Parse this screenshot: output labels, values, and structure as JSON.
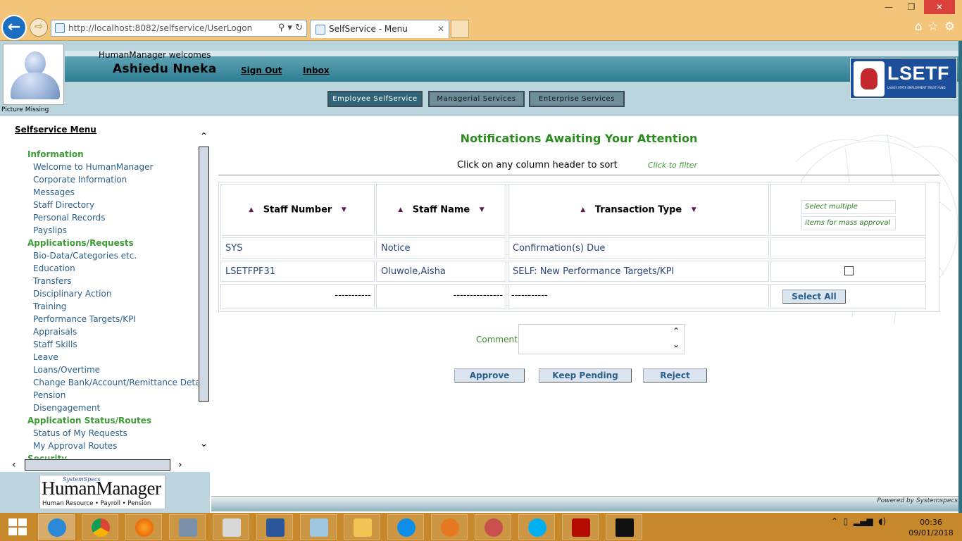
{
  "browser": {
    "url_prefix": "http://localhost",
    "url_rest": ":8082/selfservice/UserLogon",
    "tab_title": "SelfService - Menu",
    "window_controls": [
      "—",
      "❐",
      "✕"
    ]
  },
  "header": {
    "picture_missing": "Picture Missing",
    "welcome": "HumanManager welcomes",
    "user_name": "Ashiedu Nneka",
    "sign_out": "Sign Out",
    "inbox": "Inbox",
    "tabs": [
      "Employee SelfService",
      "Managerial Services",
      "Enterprise Services"
    ],
    "logo_text": "LSETF",
    "logo_sub": "LAGOS STATE EMPLOYMENT TRUST FUND"
  },
  "sidebar": {
    "title": "Selfservice Menu",
    "sections": [
      {
        "label": "Information",
        "items": [
          "Welcome to HumanManager",
          "Corporate Information",
          "Messages",
          "Staff Directory",
          "Personal Records",
          "Payslips"
        ]
      },
      {
        "label": "Applications/Requests",
        "items": [
          "Bio-Data/Categories etc.",
          "Education",
          "Transfers",
          "Disciplinary Action",
          "Training",
          "Performance Targets/KPI",
          "Appraisals",
          "Staff Skills",
          "Leave",
          "Loans/Overtime",
          "Change Bank/Account/Remittance Details",
          "Pension",
          "Disengagement"
        ]
      },
      {
        "label": "Application Status/Routes",
        "items": [
          "Status of My Requests",
          "My Approval Routes"
        ]
      },
      {
        "label": "Security",
        "items": []
      }
    ],
    "footer_logo": {
      "brand": "SystemSpecs",
      "name": "HumanManager",
      "tagline": "Human Resource • Payroll • Pension"
    }
  },
  "main": {
    "title": "Notifications Awaiting Your Attention",
    "sort_hint": "Click on any column header to sort",
    "filter_hint": "Click to filter",
    "columns": [
      "Staff Number",
      "Staff Name",
      "Transaction Type"
    ],
    "select_multiple": "Select multiple",
    "items_mass_approval": "items for mass approval",
    "rows": [
      {
        "staff_number": "SYS",
        "staff_name": "Notice",
        "transaction_type": "Confirmation(s) Due"
      },
      {
        "staff_number": "LSETFPF31",
        "staff_name": "Oluwole,Aisha",
        "transaction_type": "SELF: New Performance Targets/KPI"
      }
    ],
    "footer_dashes": [
      "-----------",
      "---------------",
      "-----------"
    ],
    "select_all": "Select All",
    "comment_label": "Comment",
    "buttons": {
      "approve": "Approve",
      "keep_pending": "Keep Pending",
      "reject": "Reject"
    },
    "powered_by": "Powered by Systemspecs"
  },
  "taskbar": {
    "apps": [
      "internet-explorer",
      "chrome",
      "firefox",
      "tools",
      "calculator",
      "word",
      "notepad",
      "file-explorer",
      "teamviewer",
      "paint",
      "snipping-tool",
      "skype",
      "acrobat",
      "command-prompt"
    ],
    "time": "00:36",
    "date": "09/01/2018"
  }
}
